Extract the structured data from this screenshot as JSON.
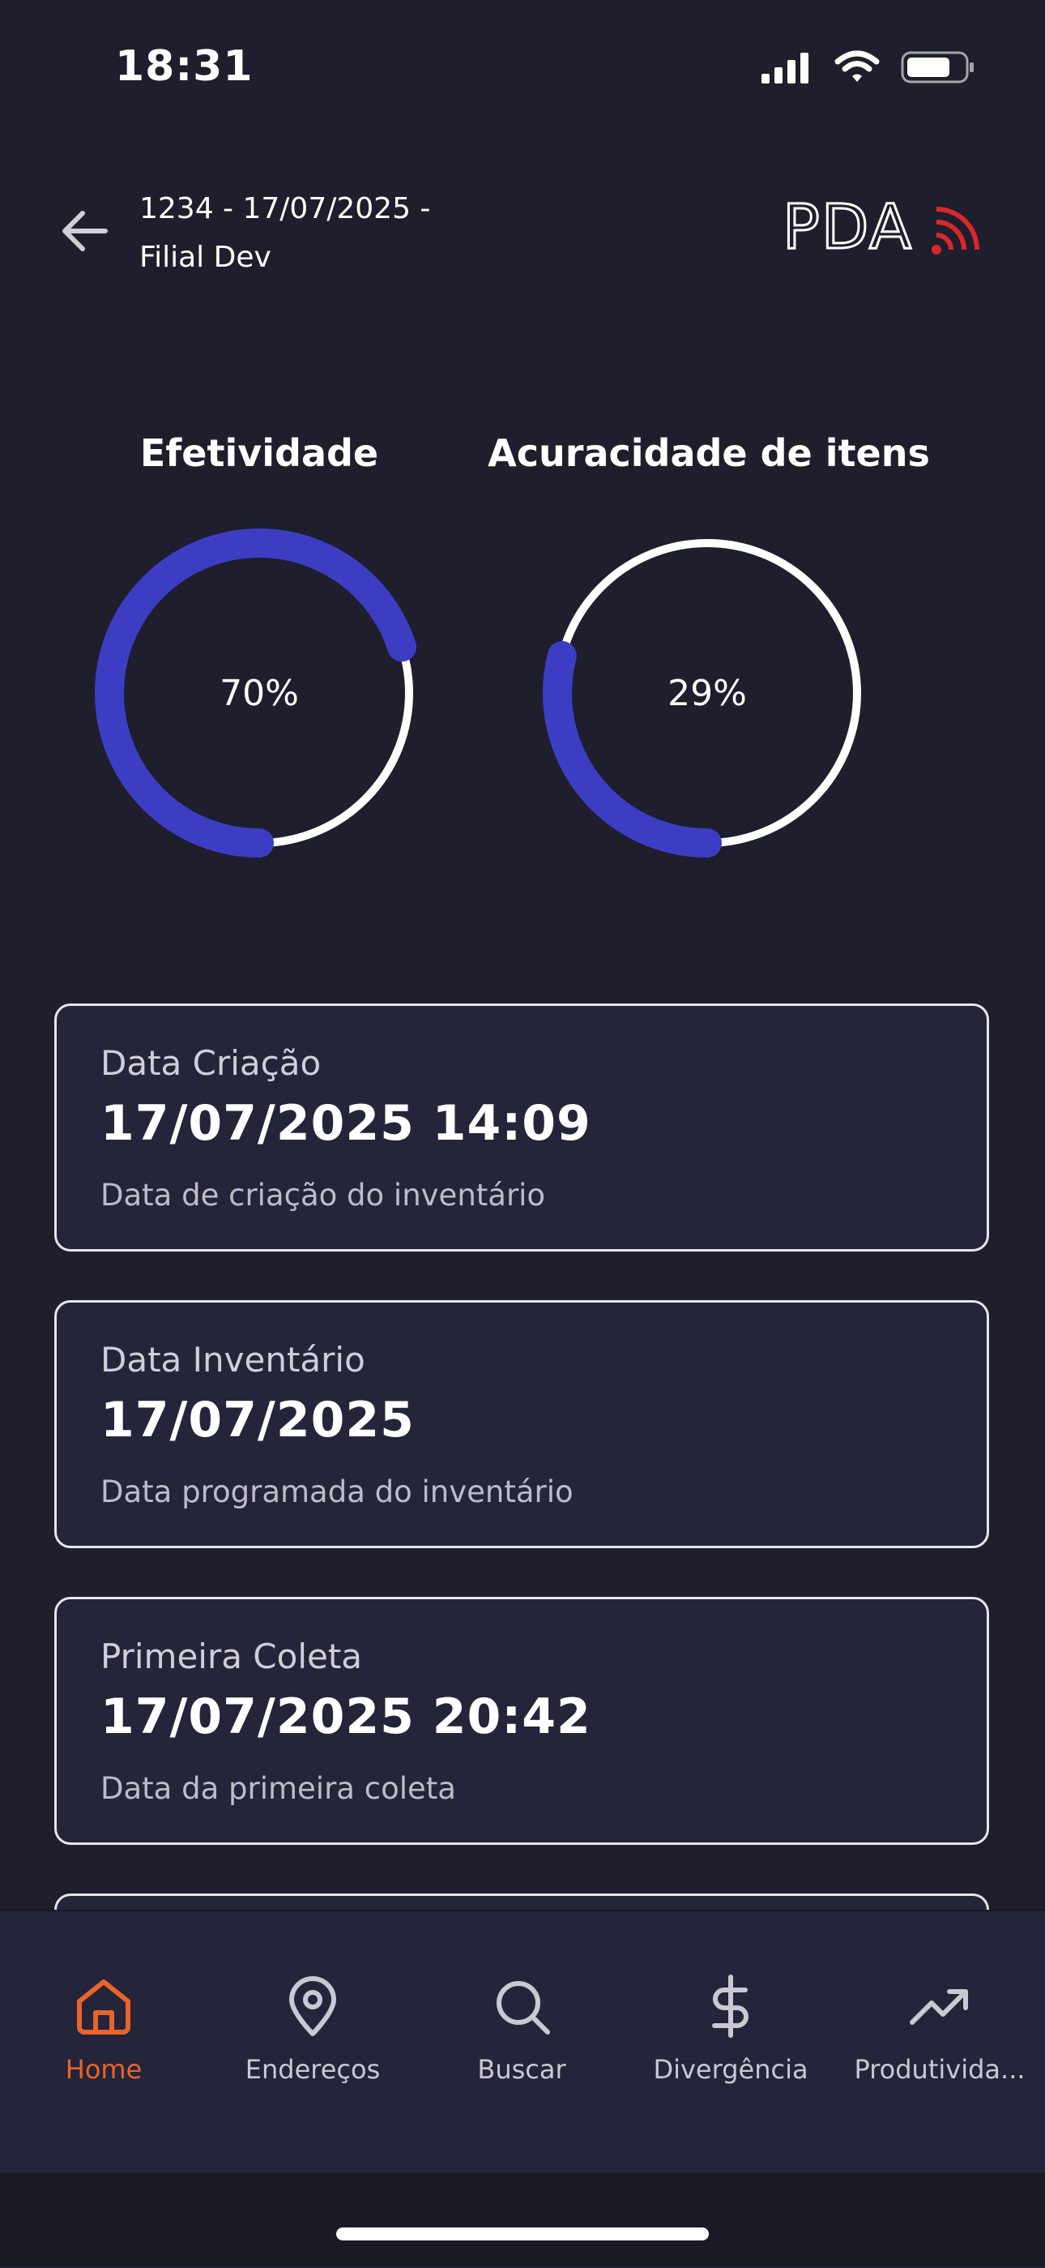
{
  "status_bar": {
    "time": "18:31"
  },
  "header": {
    "title_line1": "1234 - 17/07/2025 -",
    "title_line2": "Filial Dev",
    "logo_text": "PDA"
  },
  "charts": [
    {
      "title": "Efetividade",
      "label": "70%",
      "value": 70
    },
    {
      "title": "Acuracidade de itens",
      "label": "29%",
      "value": 29
    }
  ],
  "colors": {
    "progress": "#3d3dc4",
    "track": "#ffffff",
    "active_tab": "#e8642a",
    "logo_signal": "#d8282a"
  },
  "cards": [
    {
      "label": "Data Criação",
      "value": "17/07/2025 14:09",
      "description": "Data de criação do inventário"
    },
    {
      "label": "Data Inventário",
      "value": "17/07/2025",
      "description": "Data programada do inventário"
    },
    {
      "label": "Primeira Coleta",
      "value": "17/07/2025 20:42",
      "description": "Data da primeira coleta"
    }
  ],
  "tabs": [
    {
      "label": "Home",
      "icon": "home-icon",
      "active": true
    },
    {
      "label": "Endereços",
      "icon": "map-pin-icon",
      "active": false
    },
    {
      "label": "Buscar",
      "icon": "search-icon",
      "active": false
    },
    {
      "label": "Divergência",
      "icon": "dollar-icon",
      "active": false
    },
    {
      "label": "Produtivida...",
      "icon": "trending-up-icon",
      "active": false
    }
  ]
}
